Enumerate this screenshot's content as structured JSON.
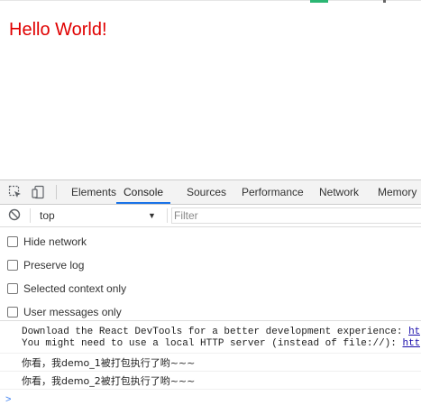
{
  "page": {
    "heading": "Hello World!"
  },
  "devtools": {
    "tabs": [
      "Elements",
      "Console",
      "Sources",
      "Performance",
      "Network",
      "Memory"
    ],
    "active_tab": "Console",
    "context": "top",
    "filter_placeholder": "Filter",
    "options": [
      "Hide network",
      "Preserve log",
      "Selected context only",
      "User messages only"
    ],
    "messages": {
      "devtools_line1": "Download the React DevTools for a better development experience: ",
      "devtools_line1_link": "ht",
      "devtools_line2": "You might need to use a local HTTP server (instead of file://): ",
      "devtools_line2_link": "htt",
      "log1": "你看，我demo_1被打包执行了哟~~~",
      "log2": "你看，我demo_2被打包执行了哟~~~"
    }
  },
  "colors": {
    "heading": "#e00000",
    "active_tab": "#1a73e8",
    "link": "#1a0dab"
  }
}
